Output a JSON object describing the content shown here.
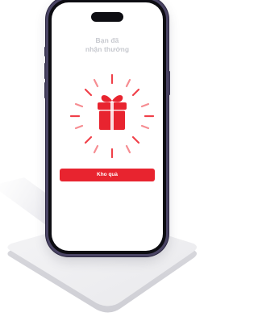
{
  "reward_screen": {
    "title_line1": "Bạn đã",
    "title_line2": "nhận thưởng",
    "cta_label": "Kho quà"
  },
  "colors": {
    "accent_red": "#e8242f",
    "ray_red": "#f0414a",
    "title_gray": "#c7c9cf",
    "phone_frame": "#4a4464"
  },
  "icons": {
    "gift": "gift-icon",
    "rays": "sparkle-rays"
  }
}
